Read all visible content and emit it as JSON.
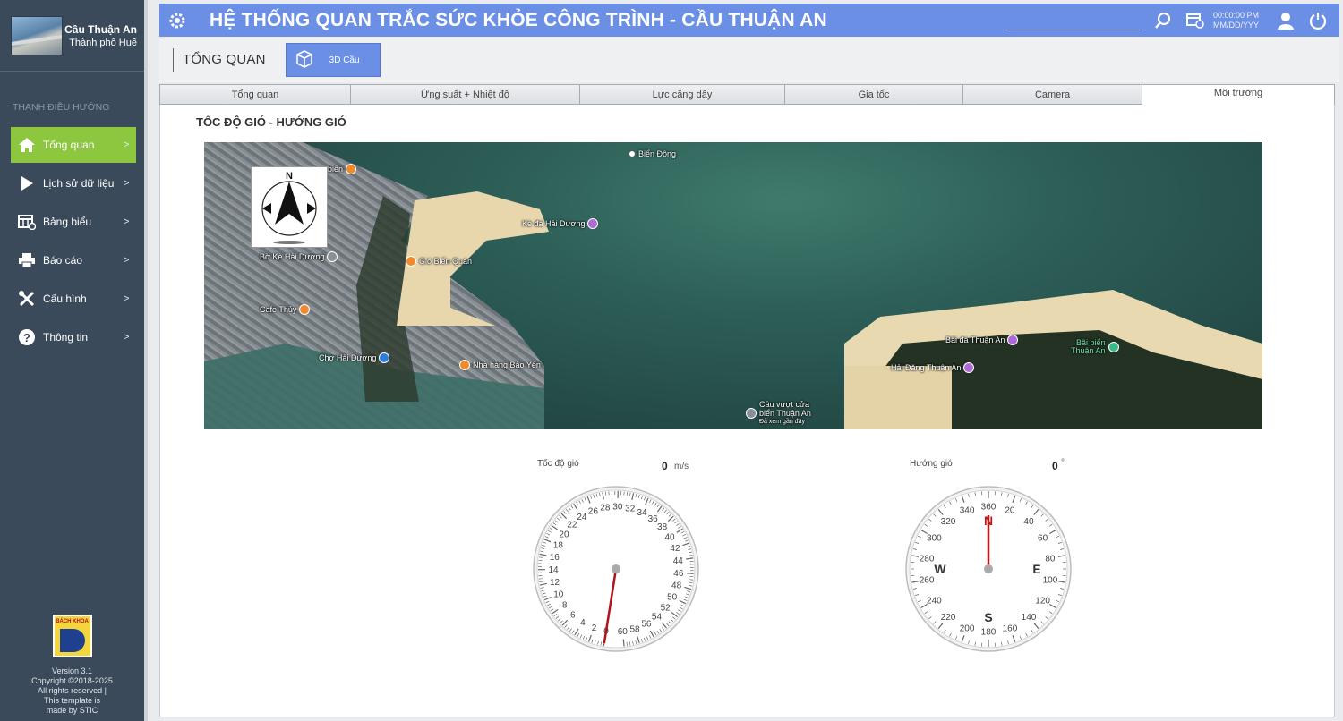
{
  "brand": {
    "title": "Cầu Thuận An",
    "subtitle": "Thành phố Huế"
  },
  "nav": {
    "heading": "THANH ĐIỀU HƯỚNG",
    "items": [
      {
        "label": "Tổng quan",
        "icon": "home-icon",
        "active": true
      },
      {
        "label": "Lịch sử dữ liệu",
        "icon": "play-icon",
        "active": false
      },
      {
        "label": "Bảng biểu",
        "icon": "table-icon",
        "active": false
      },
      {
        "label": "Báo cáo",
        "icon": "printer-icon",
        "active": false
      },
      {
        "label": "Cấu hình",
        "icon": "tools-icon",
        "active": false
      },
      {
        "label": "Thông tin",
        "icon": "question-icon",
        "active": false
      }
    ],
    "arrow": ">"
  },
  "footer": {
    "logo_text": "BÁCH KHOA",
    "version": "Version 3.1",
    "copyright": "Copyright ©2018-2025",
    "rights": "All rights reserved |",
    "template": "This template is",
    "made_by": "made by STIC"
  },
  "header": {
    "title": "HỆ THỐNG QUAN TRẮC SỨC KHỎE CÔNG TRÌNH - CẦU THUẬN AN",
    "time": "00:00:00 PM",
    "date": "MM/DD/YYY",
    "bg_color": "#6b8fe4"
  },
  "subheader": {
    "page_label": "TỔNG QUAN",
    "button_3d": "3D Cầu"
  },
  "tabs": [
    {
      "label": "Tổng quan",
      "active": false
    },
    {
      "label": "Ứng suất + Nhiệt độ",
      "active": false
    },
    {
      "label": "Lực căng dây",
      "active": false
    },
    {
      "label": "Gia tốc",
      "active": false
    },
    {
      "label": "Camera",
      "active": false
    },
    {
      "label": "Môi trường",
      "active": true
    }
  ],
  "section_title": "TỐC ĐỘ GIÓ - HƯỚNG GIÓ",
  "map": {
    "labels": {
      "bien_dong": "Biển Đông",
      "ke_da": "Kè đá Hải Dương",
      "gio_bien": "Gió Biển Quán",
      "bo_ke": "Bờ Kè Hải Dương",
      "cafe": "Cafe Thủy",
      "cho": "Chợ Hải Dương",
      "nha_hang": "Nhà hàng Bảo Yến",
      "cau_vuot": "Cầu vượt cửa",
      "bien_ta": "biển Thuận An",
      "da_xem": "Đã xem gần đây",
      "bai_da": "Bãi đá Thuận An",
      "bai_bien": "Bãi biển",
      "thuan_an": "Thuận An",
      "hai_dang": "Hải Đăng Thuận An",
      "bien": "biển"
    },
    "compass_letter": "N"
  },
  "wind_speed": {
    "label": "Tốc độ gió",
    "value": "0",
    "unit": "m/s",
    "min": 0,
    "max": 60,
    "current": 0,
    "ticks": [
      "0",
      "2",
      "4",
      "6",
      "8",
      "10",
      "12",
      "14",
      "16",
      "18",
      "20",
      "22",
      "24",
      "26",
      "28",
      "30",
      "32",
      "34",
      "36",
      "38",
      "40",
      "42",
      "44",
      "46",
      "48",
      "50",
      "52",
      "54",
      "56",
      "58",
      "60"
    ]
  },
  "wind_direction": {
    "label": "Hướng gió",
    "value": "0",
    "unit": "°",
    "current": 0,
    "ticks": [
      "360",
      "20",
      "40",
      "60",
      "80",
      "100",
      "120",
      "140",
      "160",
      "180",
      "200",
      "220",
      "240",
      "260",
      "280",
      "300",
      "320",
      "340"
    ],
    "cardinals": {
      "n": "N",
      "e": "E",
      "s": "S",
      "w": "W"
    },
    "needle_color": "#c0151b"
  }
}
